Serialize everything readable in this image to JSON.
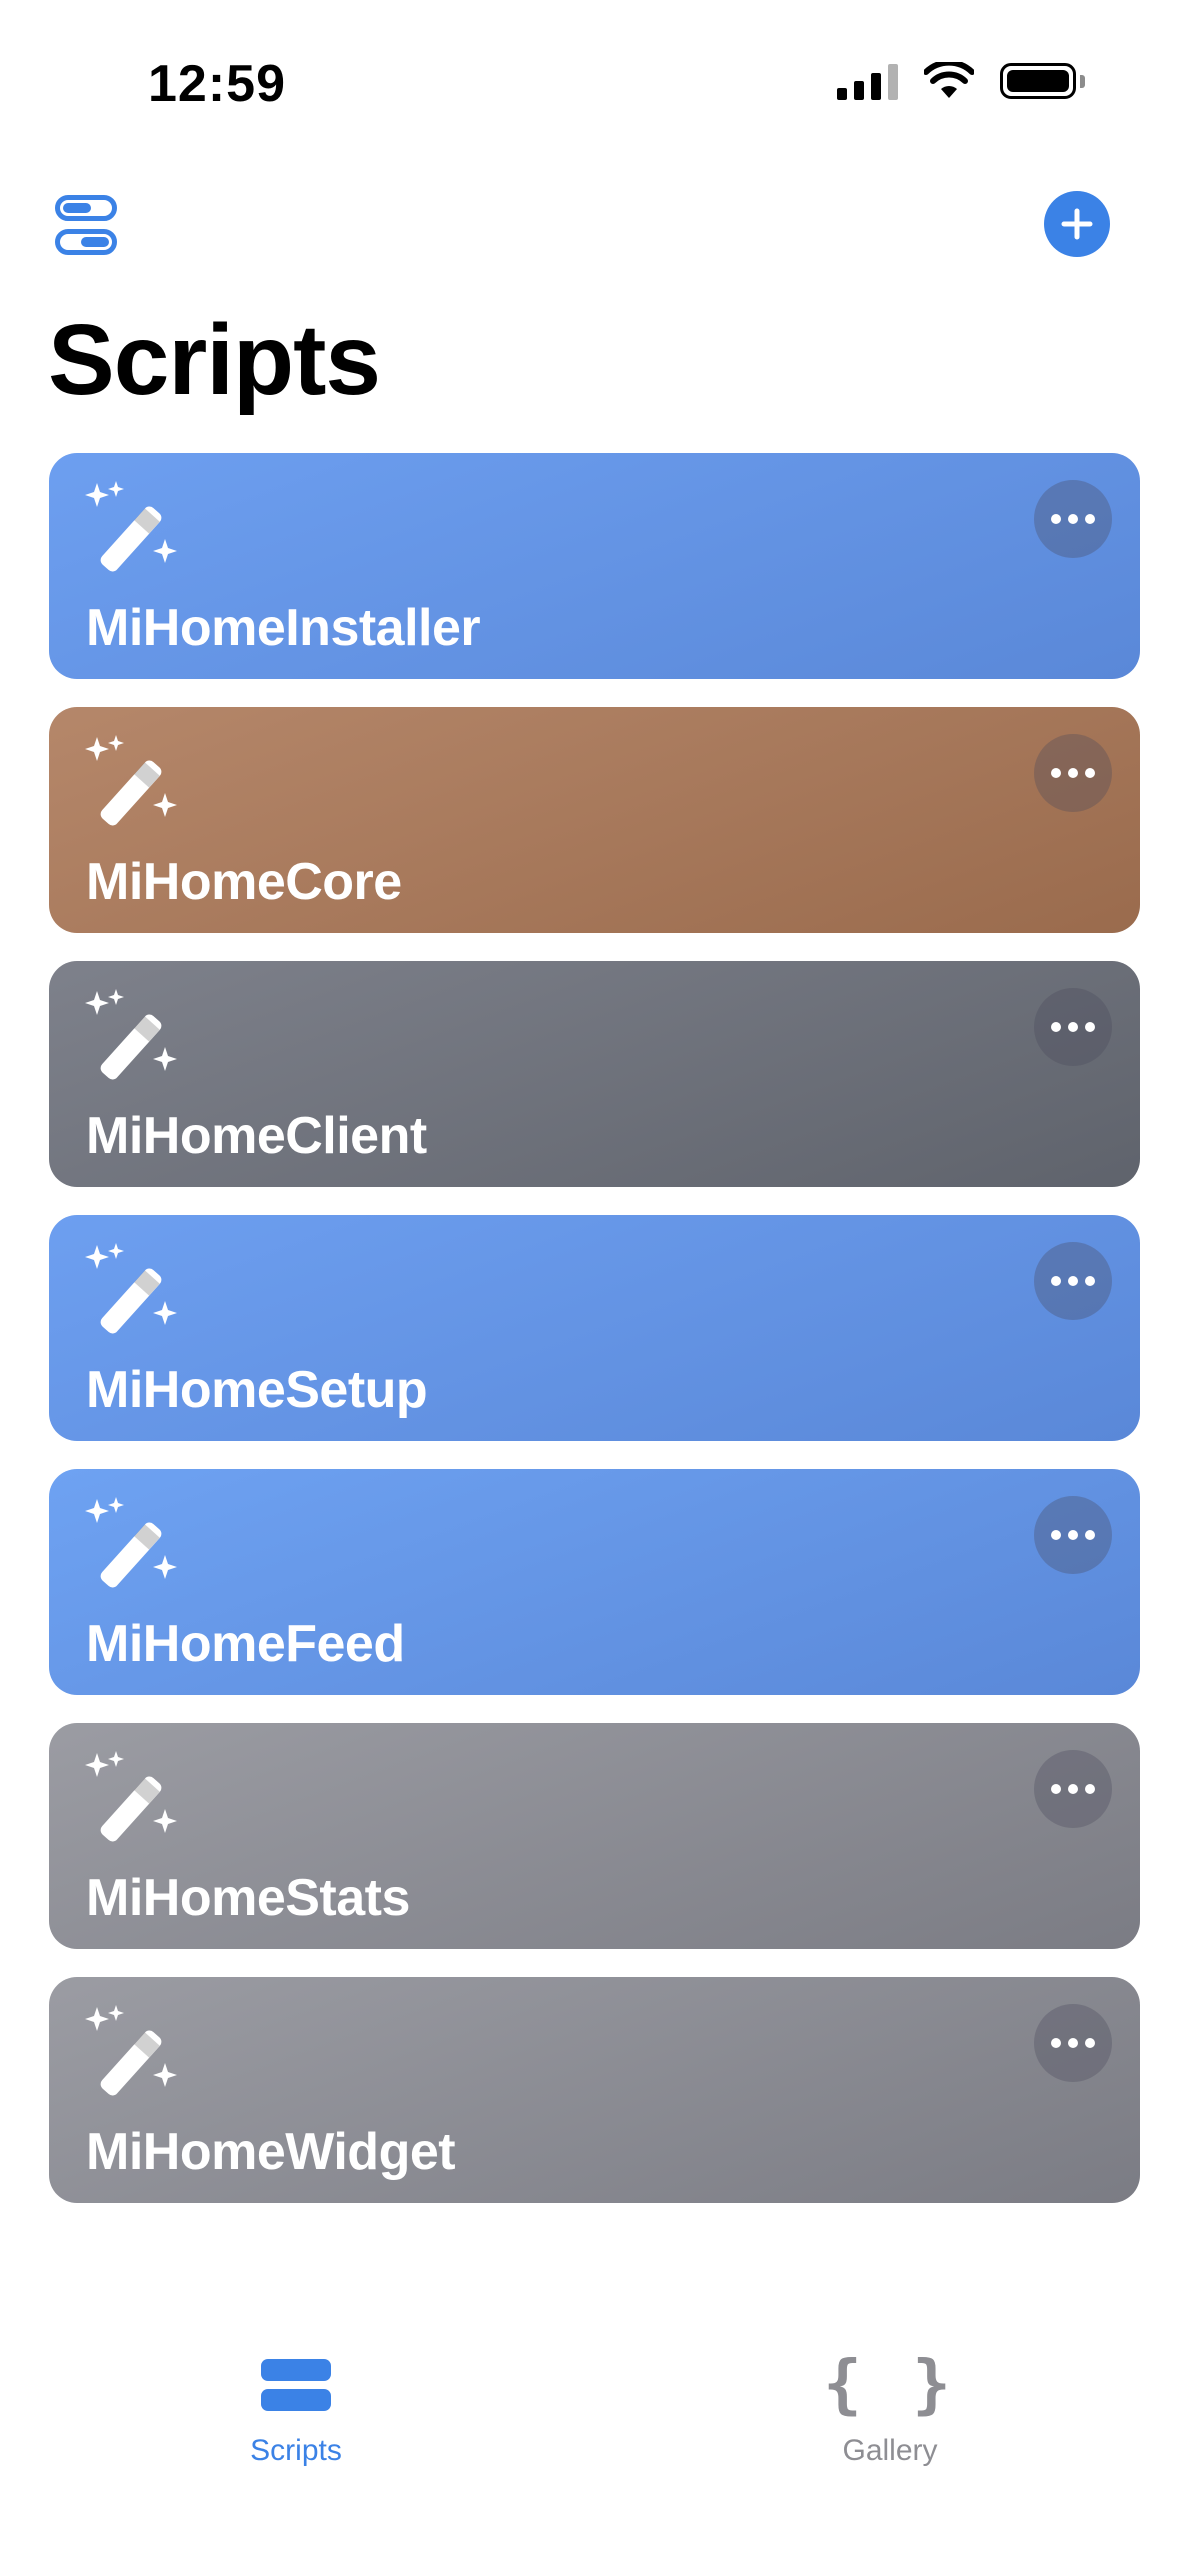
{
  "status_bar": {
    "time": "12:59"
  },
  "header": {
    "title": "Scripts"
  },
  "scripts": [
    {
      "name": "MiHomeInstaller",
      "gradient": [
        "#6d9ff0",
        "#5a88d8"
      ]
    },
    {
      "name": "MiHomeCore",
      "gradient": [
        "#b5876a",
        "#9a6b4d"
      ]
    },
    {
      "name": "MiHomeClient",
      "gradient": [
        "#7e818b",
        "#5f636c"
      ]
    },
    {
      "name": "MiHomeSetup",
      "gradient": [
        "#6d9ff0",
        "#5a88d8"
      ]
    },
    {
      "name": "MiHomeFeed",
      "gradient": [
        "#6ea2f2",
        "#5a88d8"
      ]
    },
    {
      "name": "MiHomeStats",
      "gradient": [
        "#9b9ca3",
        "#7b7c84"
      ]
    },
    {
      "name": "MiHomeWidget",
      "gradient": [
        "#9b9ca3",
        "#7b7c84"
      ]
    }
  ],
  "tab_bar": {
    "scripts_label": "Scripts",
    "gallery_label": "Gallery",
    "gallery_icon_text": "{ }"
  },
  "colors": {
    "accent": "#3b82e6",
    "inactive": "#8e8e93"
  }
}
